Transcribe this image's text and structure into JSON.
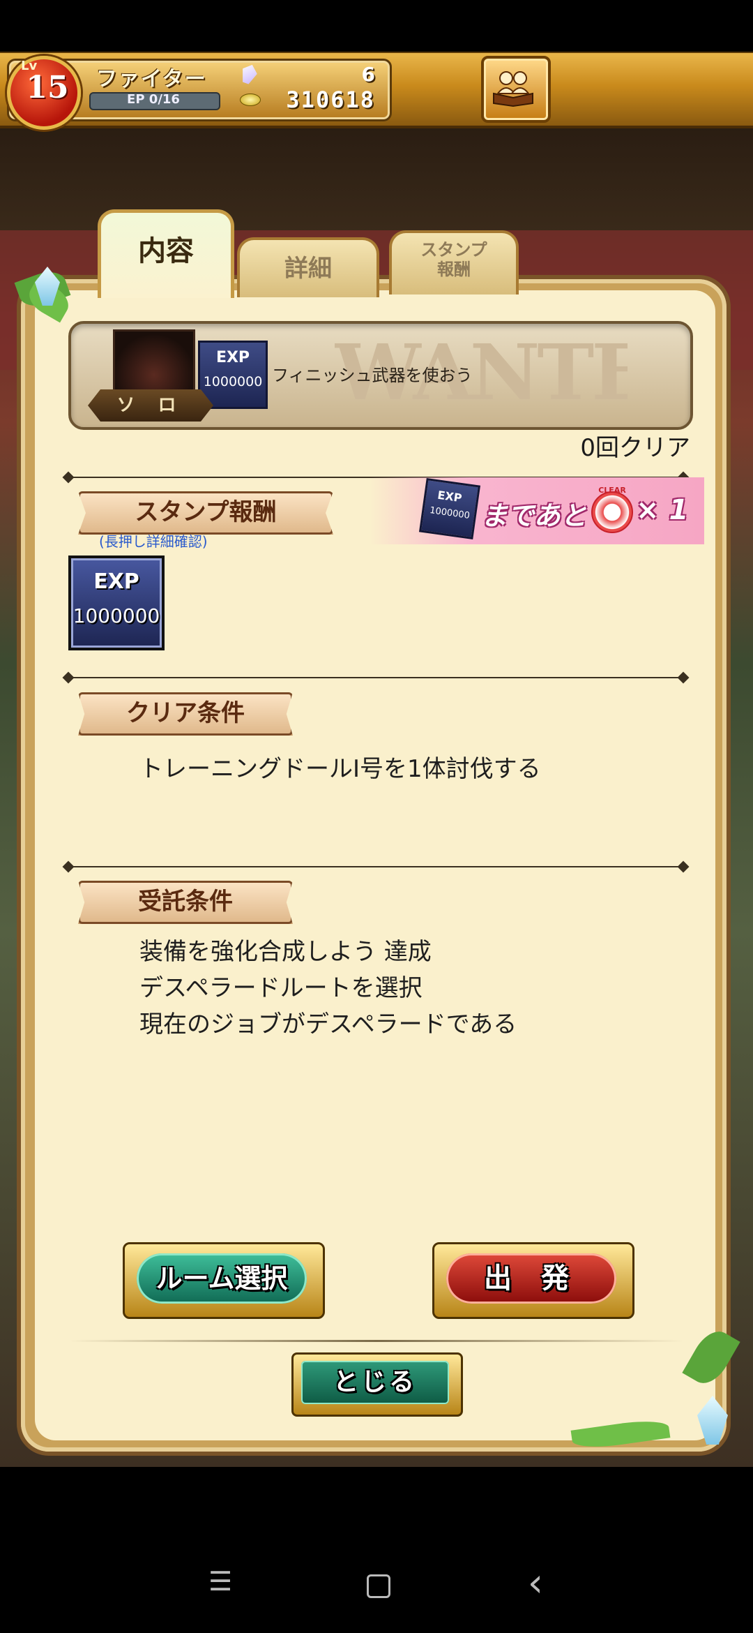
{
  "player": {
    "lv_label": "Lv",
    "level": "15",
    "job": "ファイター",
    "ep": "EP 0/16",
    "gems": "6",
    "coins": "310618"
  },
  "tabs": [
    {
      "label": "内容",
      "active": true
    },
    {
      "label": "詳細",
      "active": false
    },
    {
      "label": "スタンプ報酬",
      "line1": "スタンプ",
      "line2": "報酬",
      "active": false
    }
  ],
  "quest": {
    "mode": "ソ ロ",
    "reward_exp_label": "EXP",
    "reward_exp_value": "1000000",
    "name": "フィニッシュ武器を使おう",
    "banner_word": "WANTED",
    "clear_count": "0回クリア"
  },
  "stamp_reward": {
    "header": "スタンプ報酬",
    "hint": "(長押し詳細確認)",
    "exp_label": "EXP",
    "exp_value": "1000000",
    "promo_text": "まであと",
    "promo_stamp": "CLEAR",
    "promo_count": "× 1"
  },
  "clear_condition": {
    "header": "クリア条件",
    "lines": [
      "トレーニングドールI号を1体討伐する"
    ]
  },
  "accept_condition": {
    "header": "受託条件",
    "lines": [
      "装備を強化合成しよう 達成",
      "デスペラードルートを選択",
      "現在のジョブがデスペラードである"
    ]
  },
  "buttons": {
    "room_select": "ルーム選択",
    "depart": "出 発",
    "close": "とじる"
  },
  "nav": {
    "menu": "☰",
    "back": "‹"
  },
  "colors": {
    "panel": "#faf0cc",
    "gold_frame": "#c9a25a",
    "depart_red": "#b01a14",
    "room_green": "#1f8a6c",
    "hint_blue": "#2a5acc"
  }
}
